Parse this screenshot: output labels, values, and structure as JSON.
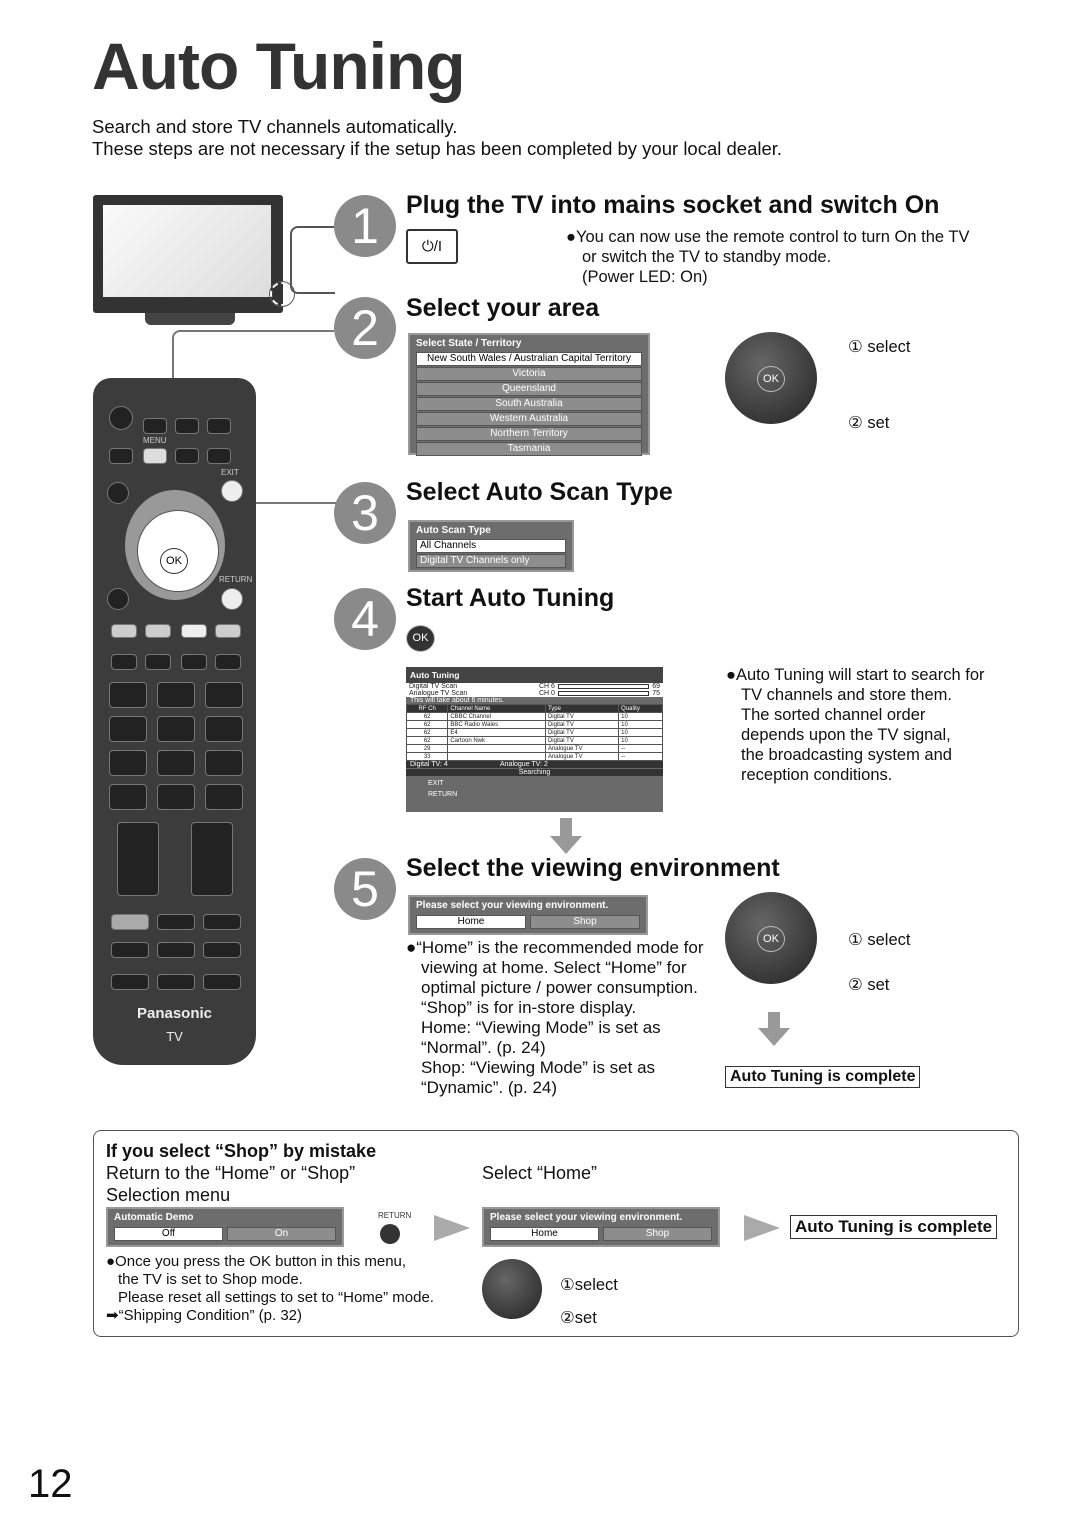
{
  "title": "Auto Tuning",
  "intro": [
    "Search and store TV channels automatically.",
    "These steps are not necessary if the setup has been completed by your local dealer."
  ],
  "steps": [
    {
      "num": "1",
      "heading": "Plug the TV into mains socket and switch On",
      "button": "⏻/I",
      "note": "●You can now use the remote control to turn On the TV",
      "note2": "or switch the TV to standby mode.",
      "note3": "(Power LED: On)"
    },
    {
      "num": "2",
      "heading": "Select your area",
      "menu_title": "Select State / Territory",
      "options": [
        "New South Wales / Australian Capital Territory",
        "Victoria",
        "Queensland",
        "South Australia",
        "Western Australia",
        "Northern Territory",
        "Tasmania"
      ],
      "select": "① select",
      "set": "② set"
    },
    {
      "num": "3",
      "heading": "Select Auto Scan Type",
      "menu_title": "Auto Scan Type",
      "options": [
        "All Channels",
        "Digital TV Channels only"
      ]
    },
    {
      "num": "4",
      "heading": "Start Auto Tuning",
      "ok": "OK",
      "screen": {
        "title": "Auto Tuning",
        "scan": [
          {
            "label": "Digital TV Scan",
            "ch": "CH 6",
            "end": "69"
          },
          {
            "label": "Analogue TV Scan",
            "ch": "CH 0",
            "end": "75"
          }
        ],
        "time": "This will take about 6 minutes.",
        "headers": [
          "RF Ch",
          "Channel Name",
          "Type",
          "Quality"
        ],
        "rows": [
          [
            "62",
            "CBBC Channel",
            "Digital TV",
            "10"
          ],
          [
            "62",
            "BBC Radio Wales",
            "Digital TV",
            "10"
          ],
          [
            "62",
            "E4",
            "Digital TV",
            "10"
          ],
          [
            "62",
            "Cartoon Nwk",
            "Digital TV",
            "10"
          ],
          [
            "29",
            "",
            "Analogue TV",
            "--"
          ],
          [
            "33",
            "",
            "Analogue TV",
            "--"
          ]
        ],
        "digital": "Digital TV: 4",
        "analogue": "Analogue TV: 2",
        "status": "Searching",
        "exit": "EXIT",
        "return": "RETURN"
      },
      "notes": [
        "●Auto Tuning will start to search for",
        "TV channels and store them.",
        "The sorted channel order",
        "depends upon the TV signal,",
        "the broadcasting system and",
        "reception conditions."
      ]
    },
    {
      "num": "5",
      "heading": "Select the viewing environment",
      "menu_title": "Please select your viewing environment.",
      "options": [
        "Home",
        "Shop"
      ],
      "notes": [
        "●“Home” is the recommended mode for",
        "viewing at home. Select “Home” for",
        "optimal picture / power consumption.",
        "“Shop” is for in-store display.",
        "Home: “Viewing Mode” is set as",
        "“Normal”. (p. 24)",
        "Shop: “Viewing Mode” is set as",
        "“Dynamic”. (p. 24)"
      ],
      "select": "① select",
      "set": "② set",
      "complete": "Auto Tuning is complete"
    }
  ],
  "mistake": {
    "heading": "If you select “Shop” by mistake",
    "left": [
      "Return to the “Home” or “Shop”",
      "Selection menu"
    ],
    "right": "Select “Home”",
    "demo_title": "Automatic Demo",
    "demo_options": [
      "Off",
      "On"
    ],
    "return": "RETURN",
    "env_title": "Please select your viewing environment.",
    "env_options": [
      "Home",
      "Shop"
    ],
    "complete": "Auto Tuning is complete",
    "notes": [
      "●Once you press the OK button in this menu,",
      "the TV is set to Shop mode.",
      "Please reset all settings to set to “Home” mode.",
      "➡“Shipping Condition” (p. 32)"
    ],
    "select": "①select",
    "set": "②set"
  },
  "remote": {
    "menu": "MENU",
    "exit": "EXIT",
    "return": "RETURN",
    "ok": "OK",
    "brand": "Panasonic",
    "tv": "TV"
  },
  "page_number": "12"
}
